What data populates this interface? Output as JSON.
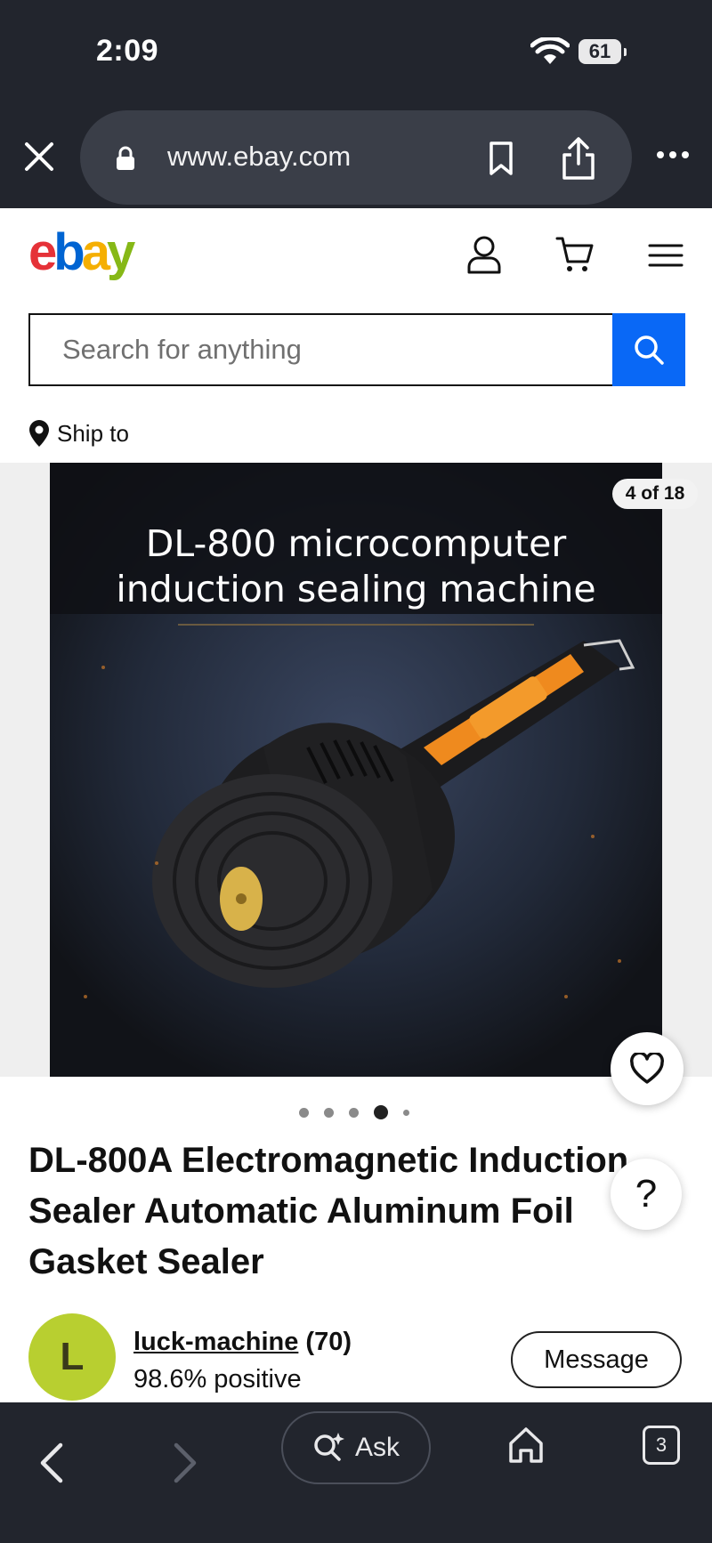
{
  "status_bar": {
    "time": "2:09",
    "battery": "61"
  },
  "browser": {
    "url": "www.ebay.com"
  },
  "ebay": {
    "logo": {
      "e": "e",
      "b": "b",
      "a": "a",
      "y": "y"
    },
    "search_placeholder": "Search for anything",
    "ship_to": "Ship to"
  },
  "gallery": {
    "counter": "4 of 18",
    "image_caption_line1": "DL-800 microcomputer",
    "image_caption_line2": "induction sealing machine",
    "dots_total": 5,
    "dot_active_index": 3
  },
  "item": {
    "title": "DL-800A Electromagnetic Induction Sealer Automatic Aluminum Foil Gasket Sealer"
  },
  "seller": {
    "avatar_letter": "L",
    "name": "luck-machine",
    "score": "(70)",
    "positive": "98.6% positive",
    "message_label": "Message"
  },
  "help": {
    "label": "?"
  },
  "toolbar": {
    "ask_label": "Ask",
    "tabs_count": "3"
  },
  "colors": {
    "chrome_bg": "#22252d",
    "search_button": "#0968f6",
    "avatar_bg": "#b8cf30",
    "ebay_red": "#e53238",
    "ebay_blue": "#0064d2",
    "ebay_yellow": "#f5af02",
    "ebay_green": "#86b817"
  }
}
